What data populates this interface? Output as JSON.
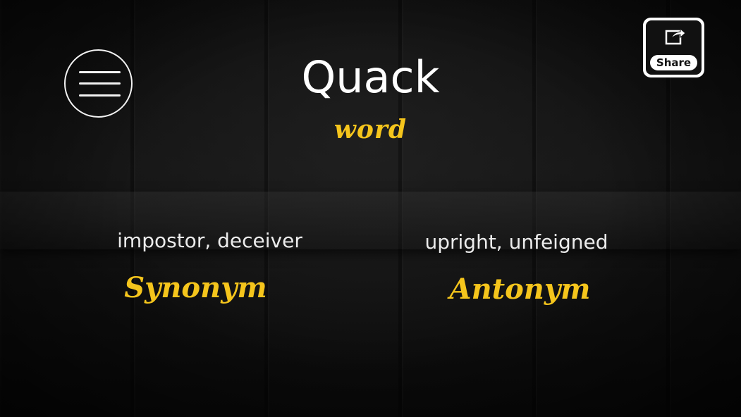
{
  "header": {
    "word": "Quack",
    "word_caption": "word",
    "share_label": "Share"
  },
  "synonym": {
    "text": "impostor, deceiver",
    "label": "Synonym"
  },
  "antonym": {
    "text": "upright, unfeigned",
    "label": "Antonym"
  },
  "icons": {
    "menu": "hamburger-menu-icon",
    "share": "share-icon"
  },
  "colors": {
    "accent": "#f5c51c",
    "text": "#ececec",
    "background": "#111111"
  }
}
